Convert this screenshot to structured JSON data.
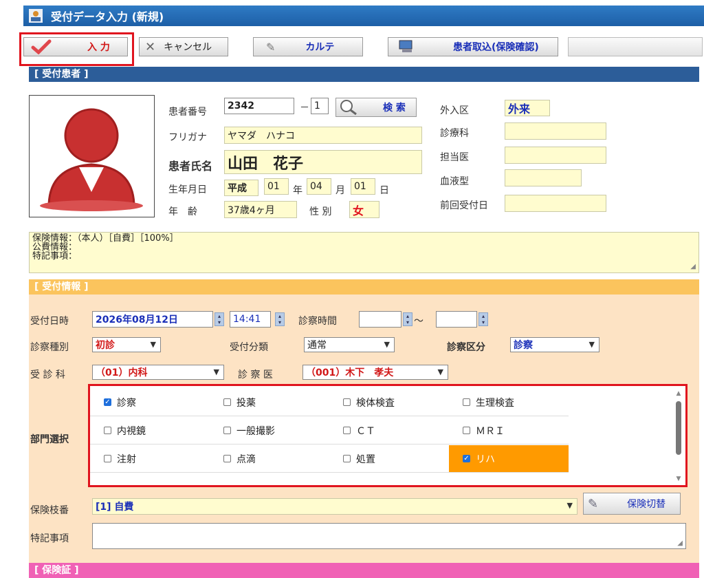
{
  "window": {
    "title": "受付データ入力 (新規)"
  },
  "toolbar": {
    "enter_label": "入 力",
    "cancel_label": "キャンセル",
    "chart_label": "カルテ",
    "import_label": "患者取込(保険確認)"
  },
  "patient": {
    "section_title": "[ 受付患者 ]",
    "number_label": "患者番号",
    "number_value": "2342",
    "number_sep": "－",
    "number_suffix": "1",
    "search_label": "検 索",
    "kana_label": "フリガナ",
    "kana_value": "ヤマダ　ハナコ",
    "name_label": "患者氏名",
    "name_value": "山田　花子",
    "birth_label": "生年月日",
    "era": "平成",
    "birth_year": "01",
    "year_unit": "年",
    "birth_month": "04",
    "month_unit": "月",
    "birth_day": "01",
    "day_unit": "日",
    "age_label": "年　齢",
    "age_value": "37歳4ヶ月",
    "sex_label": "性 別",
    "sex_value": "女",
    "visit_type_label": "外入区",
    "visit_type_value": "外来",
    "dept_label": "診療科",
    "doctor_label": "担当医",
    "blood_label": "血液型",
    "last_visit_label": "前回受付日",
    "insurance_info": "保険情報：（本人）［自費］［100%］",
    "public_info": "公費情報：",
    "notes_info": "特記事項："
  },
  "reception": {
    "section_title": "[ 受付情報 ]",
    "date_label": "受付日時",
    "date_value": "2026年08月12日",
    "time_value": "14:41",
    "exam_time_label": "診察時間",
    "tilde": "～",
    "exam_type_label": "診察種別",
    "exam_type_value": "初診",
    "category_label": "受付分類",
    "category_value": "通常",
    "exam_div_label": "診察区分",
    "exam_div_value": "診察",
    "dept_label": "受 診 科",
    "dept_value": "（01）内科",
    "doctor_label": "診 察 医",
    "doctor_value": "（001）木下　孝夫",
    "division_label": "部門選択",
    "departments": [
      {
        "label": "診察",
        "checked": true
      },
      {
        "label": "投薬",
        "checked": false
      },
      {
        "label": "検体検査",
        "checked": false
      },
      {
        "label": "生理検査",
        "checked": false
      },
      {
        "label": "内視鏡",
        "checked": false
      },
      {
        "label": "一般撮影",
        "checked": false
      },
      {
        "label": "ＣＴ",
        "checked": false
      },
      {
        "label": "ＭＲＩ",
        "checked": false
      },
      {
        "label": "注射",
        "checked": false
      },
      {
        "label": "点滴",
        "checked": false
      },
      {
        "label": "処置",
        "checked": false
      },
      {
        "label": "リハ",
        "checked": true
      }
    ],
    "insurance_branch_label": "保険枝番",
    "insurance_branch_value": "[1] 自費",
    "switch_insurance_label": "保険切替",
    "notes_label": "特記事項"
  },
  "insurance": {
    "section_title": "[ 保険証 ]"
  },
  "colors": {
    "accent_blue": "#1d5fa6",
    "highlight_red": "#e0141e",
    "selected_orange": "#ff9a00",
    "field_yellow": "#fffccf"
  }
}
